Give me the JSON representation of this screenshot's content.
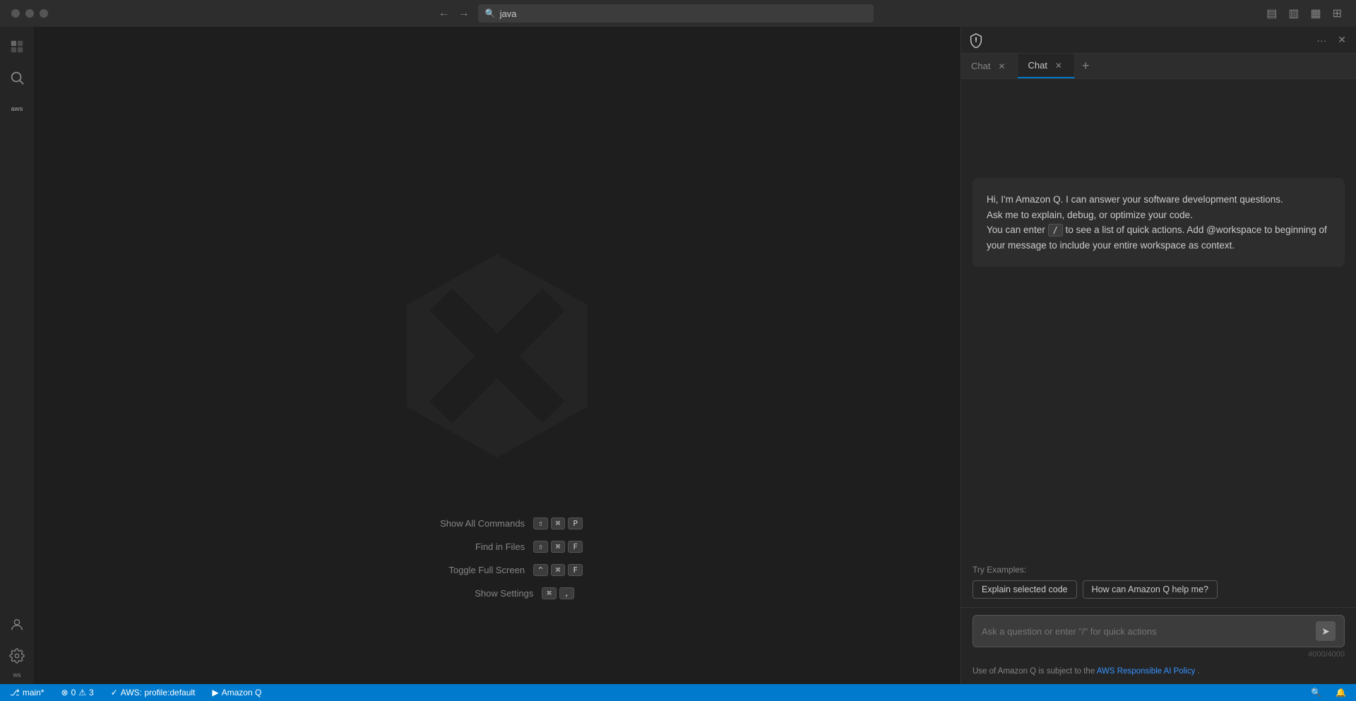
{
  "titleBar": {
    "searchPlaceholder": "java",
    "navIcons": [
      "←",
      "→"
    ]
  },
  "activityBar": {
    "icons": [
      {
        "name": "explorer-icon",
        "symbol": "⧉",
        "active": false
      },
      {
        "name": "search-icon",
        "symbol": "🔍",
        "active": false
      },
      {
        "name": "aws-icon",
        "symbol": "aws",
        "active": false
      }
    ],
    "bottomIcons": [
      {
        "name": "account-icon",
        "symbol": "👤",
        "active": false
      },
      {
        "name": "settings-icon",
        "symbol": "⚙",
        "active": false
      }
    ]
  },
  "shortcuts": [
    {
      "label": "Show All Commands",
      "keys": [
        "⇧",
        "⌘",
        "P"
      ]
    },
    {
      "label": "Find in Files",
      "keys": [
        "⇧",
        "⌘",
        "F"
      ]
    },
    {
      "label": "Toggle Full Screen",
      "keys": [
        "^",
        "⌘",
        "F"
      ]
    },
    {
      "label": "Show Settings",
      "keys": [
        "⌘",
        ","
      ]
    }
  ],
  "sidePanel": {
    "tabs": [
      {
        "label": "Chat",
        "active": false,
        "closeable": true
      },
      {
        "label": "Chat",
        "active": true,
        "closeable": true
      }
    ],
    "addTabLabel": "+",
    "moreActionsLabel": "···",
    "closeLabel": "✕",
    "welcomeMessage": {
      "line1": "Hi, I'm Amazon Q. I can answer your software development questions.",
      "line2": "Ask me to explain, debug, or optimize your code.",
      "line3prefix": "You can enter ",
      "line3code": "/",
      "line3suffix": " to see a list of quick actions. Add @workspace to beginning of your message to include your entire workspace as context."
    },
    "tryExamples": {
      "label": "Try Examples:",
      "buttons": [
        "Explain selected code",
        "How can Amazon Q help me?"
      ]
    },
    "inputPlaceholder": "Ask a question or enter \"/\" for quick actions",
    "charCount": "4000/4000",
    "footerText": "Use of Amazon Q is subject to the ",
    "footerLink": "AWS Responsible AI Policy",
    "footerLinkUrl": "#",
    "footerTextAfter": "."
  },
  "statusBar": {
    "branch": "main*",
    "errors": "0",
    "warnings": "3",
    "awsProfile": "AWS: profile:default",
    "amazonQ": "Amazon Q",
    "rightItems": [
      "🔍",
      "🔔"
    ]
  }
}
